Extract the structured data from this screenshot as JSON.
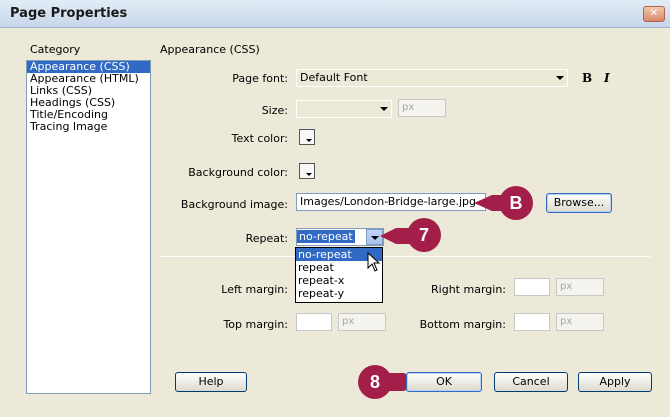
{
  "window": {
    "title": "Page Properties",
    "close_label": "✕"
  },
  "category": {
    "header": "Category",
    "items": [
      "Appearance (CSS)",
      "Appearance (HTML)",
      "Links (CSS)",
      "Headings (CSS)",
      "Title/Encoding",
      "Tracing Image"
    ],
    "selected": "Appearance (CSS)"
  },
  "section_title": "Appearance (CSS)",
  "form": {
    "page_font_label": "Page font:",
    "page_font_value": "Default Font",
    "bold_label": "B",
    "italic_label": "I",
    "size_label": "Size:",
    "size_unit": "px",
    "text_color_label": "Text color:",
    "bg_color_label": "Background color:",
    "bg_image_label": "Background image:",
    "bg_image_value": "Images/London-Bridge-large.jpg",
    "browse_label": "Browse...",
    "repeat_label": "Repeat:",
    "repeat_value": "no-repeat",
    "repeat_options": [
      "no-repeat",
      "repeat",
      "repeat-x",
      "repeat-y"
    ],
    "left_margin_label": "Left margin:",
    "right_margin_label": "Right margin:",
    "top_margin_label": "Top margin:",
    "bottom_margin_label": "Bottom margin:",
    "margin_unit": "px"
  },
  "buttons": {
    "help": "Help",
    "ok": "OK",
    "cancel": "Cancel",
    "apply": "Apply"
  },
  "callouts": {
    "b": "B",
    "seven": "7",
    "eight": "8"
  },
  "colors": {
    "callout": "#a41e4a",
    "selection": "#316ac5"
  }
}
